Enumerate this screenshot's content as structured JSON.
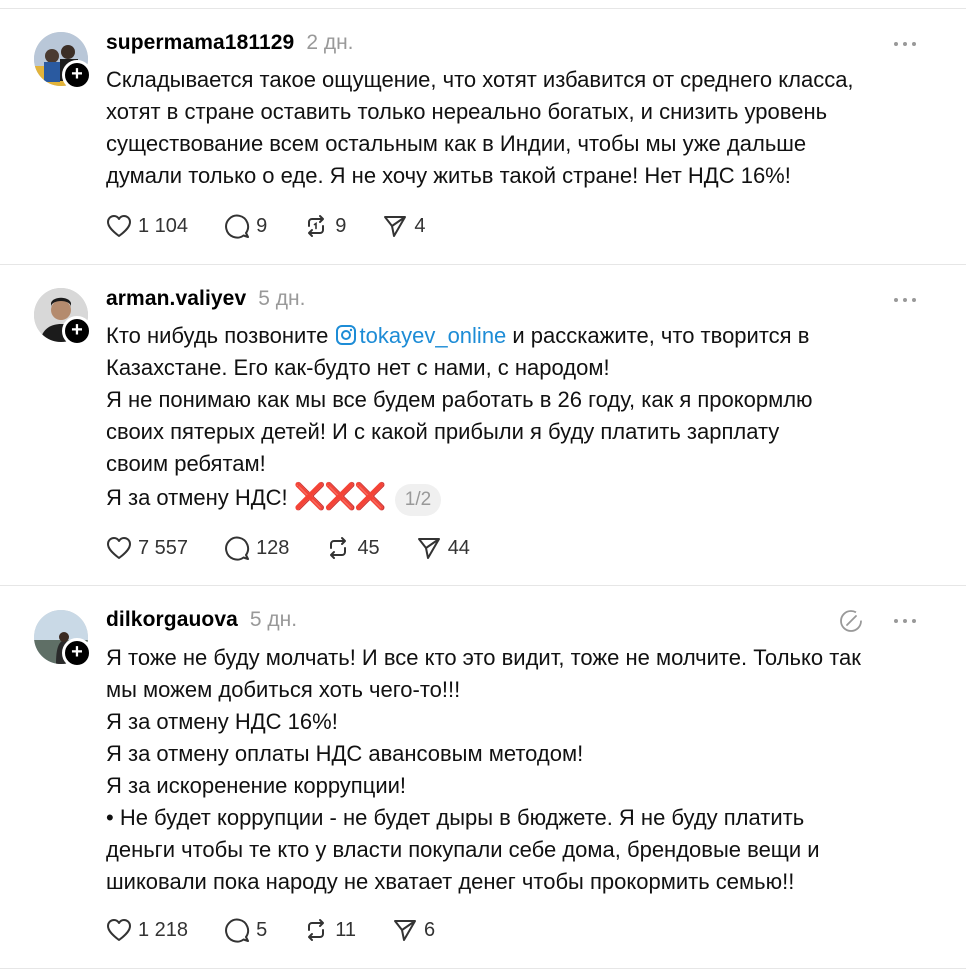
{
  "posts": [
    {
      "username": "supermama181129",
      "time": "2 дн.",
      "lines": [
        "Складывается такое ощущение, что хотят избавится от среднего класса,",
        "хотят в стране оставить только нереально богатых, и снизить уровень",
        "существование всем остальным как в Индии, чтобы мы уже дальше",
        "думали только о еде. Я не хочу житьв такой стране! Нет НДС 16%!"
      ],
      "likes": "1 104",
      "replies": "9",
      "reposts": "9",
      "shares": "4"
    },
    {
      "username": "arman.valiyev",
      "time": "5 дн.",
      "line1_before": "Кто нибудь позвоните ",
      "mention": "tokayev_online",
      "line1_after": " и расскажите, что творится в",
      "lines": [
        "Казахстане. Его как-будто нет с нами, с народом!",
        "Я не понимаю как мы все будем работать в 26 году, как я прокормлю",
        "своих пятерых детей! И с какой прибыли я буду платить зарплату",
        "своим ребятам!"
      ],
      "last_line": "Я за отмену НДС!",
      "emoji": "❌❌❌",
      "page": "1/2",
      "likes": "7 557",
      "replies": "128",
      "reposts": "45",
      "shares": "44"
    },
    {
      "username": "dilkorgauova",
      "time": "5 дн.",
      "lines": [
        "Я тоже не буду молчать! И все кто это видит, тоже не молчите. Только так",
        "мы можем добиться хоть чего-то!!!",
        "Я за отмену НДС 16%!",
        "Я за отмену оплаты НДС авансовым методом!",
        "Я за искоренение коррупции!",
        "• Не будет коррупции - не будет дыры в бюджете. Я не буду платить",
        "деньги чтобы те кто у власти покупали себе дома, брендовые вещи и",
        "шиковали пока народу не хватает денег чтобы прокормить семью!!"
      ],
      "likes": "1 218",
      "replies": "5",
      "reposts": "11",
      "shares": "6"
    }
  ],
  "icons": {
    "like": "heart-icon",
    "reply": "comment-icon",
    "repost": "repost-icon",
    "share": "send-icon",
    "more": "more-icon",
    "follow": "plus-icon",
    "instagram": "instagram-icon",
    "edited": "edited-icon"
  },
  "colors": {
    "mention": "#1d8cd6",
    "muted": "#999999",
    "emoji_red": "#e0201f",
    "divider": "#e6e6e6"
  }
}
